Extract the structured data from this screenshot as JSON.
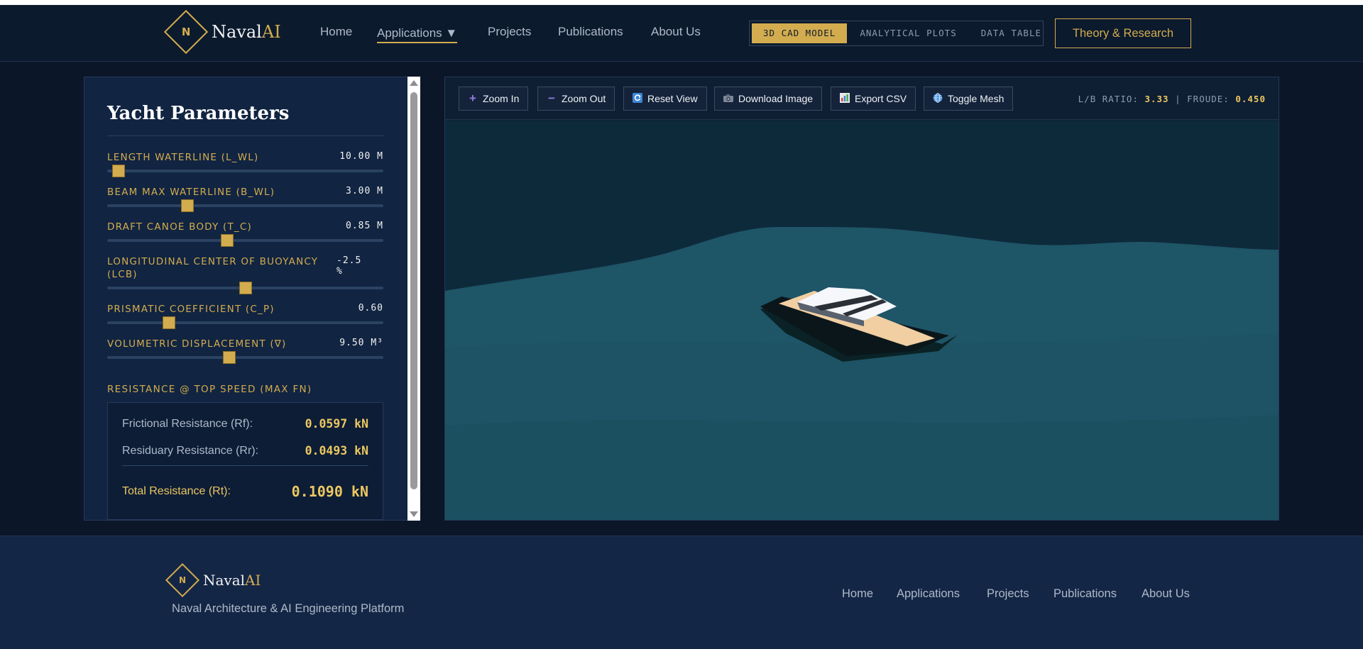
{
  "brand": {
    "initial": "N",
    "name_main": "Naval",
    "name_accent": "AI"
  },
  "nav": {
    "home": "Home",
    "applications": "Applications ▼",
    "projects": "Projects",
    "publications": "Publications",
    "about": "About Us"
  },
  "view_tabs": [
    "3D CAD MODEL",
    "ANALYTICAL PLOTS",
    "DATA TABLE"
  ],
  "active_view_tab": "3D CAD MODEL",
  "theory_button": "Theory & Research",
  "panel": {
    "title": "Yacht Parameters",
    "params": [
      {
        "label": "LENGTH WATERLINE (L_WL)",
        "value": "10.00 M",
        "slider_fraction": 0.02
      },
      {
        "label": "BEAM MAX WATERLINE (B_WL)",
        "value": "3.00 M",
        "slider_fraction": 0.28
      },
      {
        "label": "DRAFT CANOE BODY (T_C)",
        "value": "0.85 M",
        "slider_fraction": 0.43
      },
      {
        "label": "LONGITUDINAL CENTER OF BUOYANCY (LCB)",
        "value": "-2.5 %",
        "slider_fraction": 0.5
      },
      {
        "label": "PRISMATIC COEFFICIENT (C_P)",
        "value": "0.60",
        "slider_fraction": 0.21
      },
      {
        "label": "VOLUMETRIC DISPLACEMENT (∇)",
        "value": "9.50 M³",
        "slider_fraction": 0.44
      }
    ],
    "resistance_heading": "RESISTANCE @ TOP SPEED (MAX FN)",
    "frictional_label": "Frictional Resistance (Rf):",
    "frictional_value": "0.0597 kN",
    "residuary_label": "Residuary Resistance (Rr):",
    "residuary_value": "0.0493 kN",
    "total_label": "Total Resistance (Rt):",
    "total_value": "0.1090 kN"
  },
  "toolbar": {
    "zoom_in": "Zoom In",
    "zoom_out": "Zoom Out",
    "reset_view": "Reset View",
    "download_image": "Download Image",
    "export_csv": "Export CSV",
    "toggle_mesh": "Toggle Mesh"
  },
  "readout": {
    "lb_label": "L/B RATIO:",
    "lb_value": "3.33",
    "separator": "|",
    "froude_label": "FROUDE:",
    "froude_value": "0.450"
  },
  "icons": {
    "zoom_in": "plus-icon",
    "zoom_out": "minus-icon",
    "reset_view": "refresh-icon",
    "download_image": "camera-icon",
    "export_csv": "bar-chart-icon",
    "toggle_mesh": "globe-icon"
  },
  "colors": {
    "accent_gold": "#d2ac4e",
    "value_gold": "#ecc760",
    "background": "#0b1628",
    "panel": "#112442",
    "sea": "#1e5567"
  },
  "footer": {
    "tagline": "Naval Architecture & AI Engineering Platform",
    "links": [
      "Home",
      "Applications",
      "Projects",
      "Publications",
      "About Us"
    ]
  }
}
